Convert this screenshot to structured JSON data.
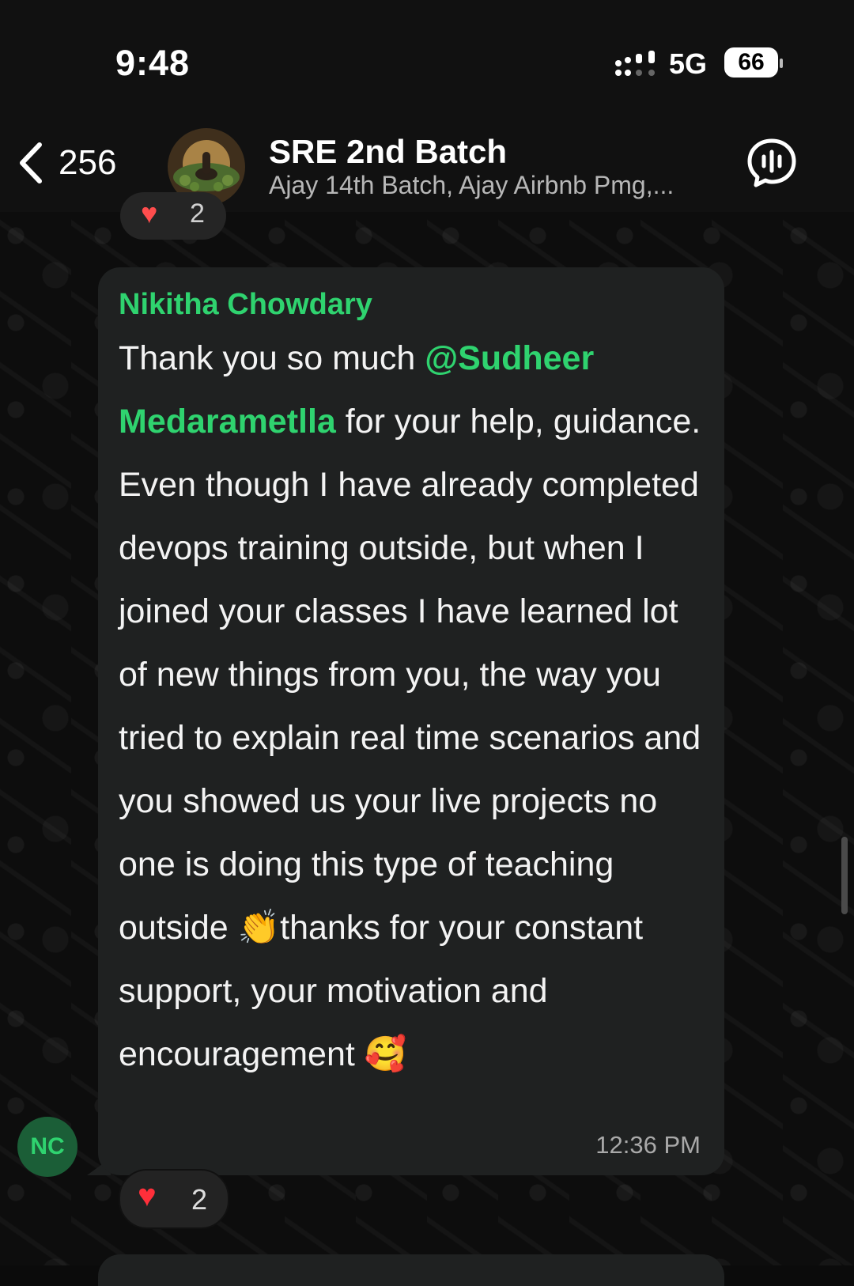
{
  "status_bar": {
    "time": "9:48",
    "network": "5G",
    "battery": "66"
  },
  "header": {
    "back_count": "256",
    "title": "SRE 2nd Batch",
    "subtitle": "Ajay 14th Batch, Ajay Airbnb Pmg,..."
  },
  "previous_message": {
    "reaction_emoji": "♥",
    "reaction_count": "2"
  },
  "message": {
    "sender": "Nikitha Chowdary",
    "text_part1": "Thank you so much ",
    "mention": "@Sudheer Medarametlla",
    "text_part2": " for your help, guidance. Even though I have already completed devops training outside, but when I joined your classes I have learned lot of new things from you, the way you tried to explain real time scenarios and you showed us your live projects no one is doing this type of teaching outside ",
    "clap_emoji": "👏",
    "text_part3": "thanks for your constant support, your motivation and encouragement ",
    "love_emoji": "🥰",
    "time": "12:36 PM",
    "sender_initials": "NC",
    "reaction_emoji": "♥",
    "reaction_count": "2"
  },
  "colors": {
    "accent_green": "#2fd36f",
    "bubble": "#1f2121",
    "background": "#0d0d0d"
  }
}
